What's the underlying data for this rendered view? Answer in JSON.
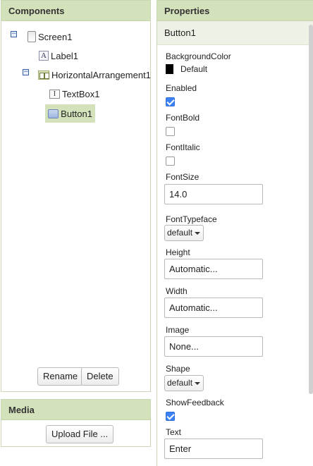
{
  "components": {
    "title": "Components",
    "tree": [
      {
        "label": "Screen1",
        "icon": "screen-icon",
        "toggle": "−"
      },
      {
        "label": "Label1",
        "icon": "label-icon",
        "icon_glyph": "A"
      },
      {
        "label": "HorizontalArrangement1",
        "icon": "horizontal-arrangement-icon",
        "toggle": "−"
      },
      {
        "label": "TextBox1",
        "icon": "textbox-icon",
        "icon_glyph": "I"
      },
      {
        "label": "Button1",
        "icon": "button-icon",
        "selected": true
      }
    ],
    "rename_label": "Rename",
    "delete_label": "Delete"
  },
  "media": {
    "title": "Media",
    "upload_label": "Upload File ..."
  },
  "properties": {
    "title": "Properties",
    "selected_component": "Button1",
    "background_color": {
      "label": "BackgroundColor",
      "value": "Default",
      "swatch": "#000000"
    },
    "enabled": {
      "label": "Enabled",
      "checked": true
    },
    "font_bold": {
      "label": "FontBold",
      "checked": false
    },
    "font_italic": {
      "label": "FontItalic",
      "checked": false
    },
    "font_size": {
      "label": "FontSize",
      "value": "14.0"
    },
    "font_typeface": {
      "label": "FontTypeface",
      "value": "default"
    },
    "height": {
      "label": "Height",
      "value": "Automatic..."
    },
    "width": {
      "label": "Width",
      "value": "Automatic..."
    },
    "image": {
      "label": "Image",
      "value": "None..."
    },
    "shape": {
      "label": "Shape",
      "value": "default"
    },
    "show_feedback": {
      "label": "ShowFeedback",
      "checked": true
    },
    "text": {
      "label": "Text",
      "value": "Enter"
    }
  },
  "colors": {
    "header_bg": "#d4e2bb",
    "selection_bg": "#d4e2bb",
    "checkbox_blue": "#3b82f6"
  }
}
